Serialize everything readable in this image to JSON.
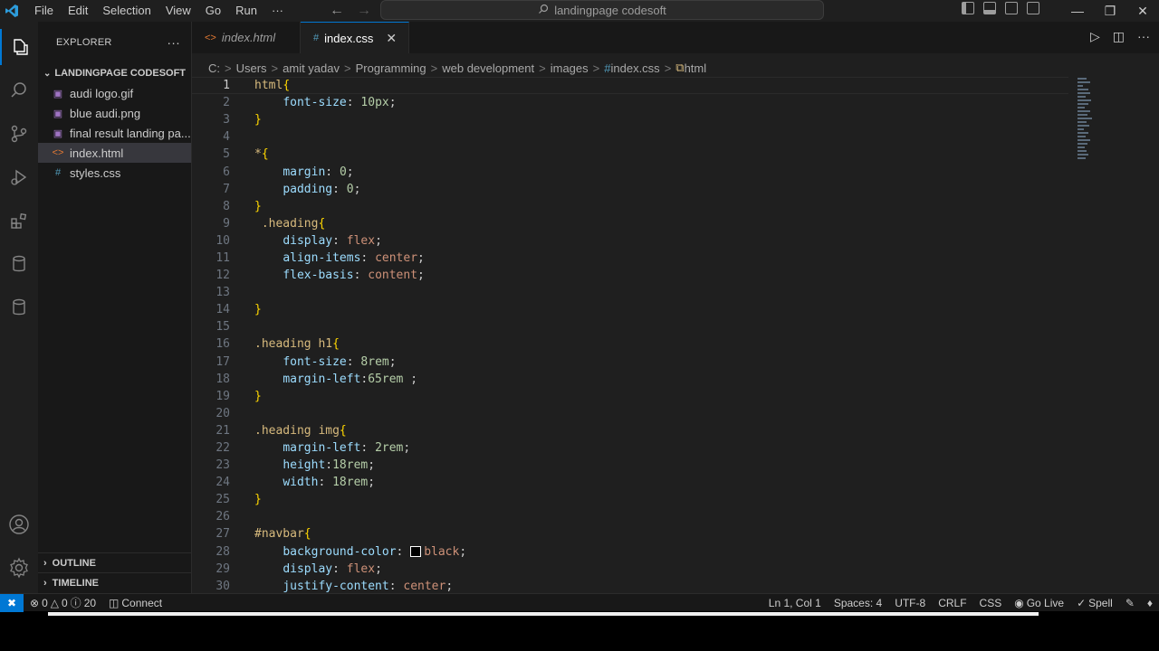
{
  "menu": [
    "File",
    "Edit",
    "Selection",
    "View",
    "Go",
    "Run",
    "···"
  ],
  "command_center": "landingpage codesoft",
  "explorer": {
    "title": "EXPLORER",
    "folder": "LANDINGPAGE CODESOFT",
    "files": [
      {
        "name": "audi logo.gif",
        "icon": "image-icon",
        "selected": false
      },
      {
        "name": "blue audi.png",
        "icon": "image-icon",
        "selected": false
      },
      {
        "name": "final result landing pa...",
        "icon": "image-icon",
        "selected": false
      },
      {
        "name": "index.html",
        "icon": "html-file-icon",
        "selected": true
      },
      {
        "name": "styles.css",
        "icon": "css-file-icon",
        "selected": false
      }
    ],
    "outline": "OUTLINE",
    "timeline": "TIMELINE"
  },
  "tabs": [
    {
      "label": "index.html",
      "icon": "html-file-icon",
      "active": false
    },
    {
      "label": "index.css",
      "icon": "css-file-icon",
      "active": true
    }
  ],
  "breadcrumb": [
    "C:",
    "Users",
    "amit yadav",
    "Programming",
    "web development",
    "images",
    "index.css",
    "html"
  ],
  "code_lines": [
    {
      "n": "1",
      "t": [
        [
          "sel",
          "html"
        ],
        [
          "br",
          "{"
        ]
      ]
    },
    {
      "n": "2",
      "t": [
        [
          "p",
          "    "
        ],
        [
          "prop",
          "font-size"
        ],
        [
          "p",
          ": "
        ],
        [
          "num",
          "10px"
        ],
        [
          "p",
          ";"
        ]
      ]
    },
    {
      "n": "3",
      "t": [
        [
          "br",
          "}"
        ]
      ]
    },
    {
      "n": "4",
      "t": []
    },
    {
      "n": "5",
      "t": [
        [
          "sel",
          "*"
        ],
        [
          "br",
          "{"
        ]
      ]
    },
    {
      "n": "6",
      "t": [
        [
          "p",
          "    "
        ],
        [
          "prop",
          "margin"
        ],
        [
          "p",
          ": "
        ],
        [
          "num",
          "0"
        ],
        [
          "p",
          ";"
        ]
      ]
    },
    {
      "n": "7",
      "t": [
        [
          "p",
          "    "
        ],
        [
          "prop",
          "padding"
        ],
        [
          "p",
          ": "
        ],
        [
          "num",
          "0"
        ],
        [
          "p",
          ";"
        ]
      ]
    },
    {
      "n": "8",
      "t": [
        [
          "br",
          "}"
        ]
      ]
    },
    {
      "n": "9",
      "t": [
        [
          "p",
          " "
        ],
        [
          "sel",
          ".heading"
        ],
        [
          "br",
          "{"
        ]
      ]
    },
    {
      "n": "10",
      "t": [
        [
          "p",
          "    "
        ],
        [
          "prop",
          "display"
        ],
        [
          "p",
          ": "
        ],
        [
          "val",
          "flex"
        ],
        [
          "p",
          ";"
        ]
      ]
    },
    {
      "n": "11",
      "t": [
        [
          "p",
          "    "
        ],
        [
          "prop",
          "align-items"
        ],
        [
          "p",
          ": "
        ],
        [
          "val",
          "center"
        ],
        [
          "p",
          ";"
        ]
      ]
    },
    {
      "n": "12",
      "t": [
        [
          "p",
          "    "
        ],
        [
          "prop",
          "flex-basis"
        ],
        [
          "p",
          ": "
        ],
        [
          "val",
          "content"
        ],
        [
          "p",
          ";"
        ]
      ]
    },
    {
      "n": "13",
      "t": []
    },
    {
      "n": "14",
      "t": [
        [
          "br",
          "}"
        ]
      ]
    },
    {
      "n": "15",
      "t": []
    },
    {
      "n": "16",
      "t": [
        [
          "sel",
          ".heading h1"
        ],
        [
          "br",
          "{"
        ]
      ]
    },
    {
      "n": "17",
      "t": [
        [
          "p",
          "    "
        ],
        [
          "prop",
          "font-size"
        ],
        [
          "p",
          ": "
        ],
        [
          "num",
          "8rem"
        ],
        [
          "p",
          ";"
        ]
      ]
    },
    {
      "n": "18",
      "t": [
        [
          "p",
          "    "
        ],
        [
          "prop",
          "margin-left"
        ],
        [
          "p",
          ":"
        ],
        [
          "num",
          "65rem"
        ],
        [
          "p",
          " ;"
        ]
      ]
    },
    {
      "n": "19",
      "t": [
        [
          "br",
          "}"
        ]
      ]
    },
    {
      "n": "20",
      "t": []
    },
    {
      "n": "21",
      "t": [
        [
          "sel",
          ".heading img"
        ],
        [
          "br",
          "{"
        ]
      ]
    },
    {
      "n": "22",
      "t": [
        [
          "p",
          "    "
        ],
        [
          "prop",
          "margin-left"
        ],
        [
          "p",
          ": "
        ],
        [
          "num",
          "2rem"
        ],
        [
          "p",
          ";"
        ]
      ]
    },
    {
      "n": "23",
      "t": [
        [
          "p",
          "    "
        ],
        [
          "prop",
          "height"
        ],
        [
          "p",
          ":"
        ],
        [
          "num",
          "18rem"
        ],
        [
          "p",
          ";"
        ]
      ]
    },
    {
      "n": "24",
      "t": [
        [
          "p",
          "    "
        ],
        [
          "prop",
          "width"
        ],
        [
          "p",
          ": "
        ],
        [
          "num",
          "18rem"
        ],
        [
          "p",
          ";"
        ]
      ]
    },
    {
      "n": "25",
      "t": [
        [
          "br",
          "}"
        ]
      ]
    },
    {
      "n": "26",
      "t": []
    },
    {
      "n": "27",
      "t": [
        [
          "sel",
          "#navbar"
        ],
        [
          "br",
          "{"
        ]
      ]
    },
    {
      "n": "28",
      "t": [
        [
          "p",
          "    "
        ],
        [
          "prop",
          "background-color"
        ],
        [
          "p",
          ": "
        ],
        [
          "swatch",
          ""
        ],
        [
          "val",
          "black"
        ],
        [
          "p",
          ";"
        ]
      ]
    },
    {
      "n": "29",
      "t": [
        [
          "p",
          "    "
        ],
        [
          "prop",
          "display"
        ],
        [
          "p",
          ": "
        ],
        [
          "val",
          "flex"
        ],
        [
          "p",
          ";"
        ]
      ]
    },
    {
      "n": "30",
      "t": [
        [
          "p",
          "    "
        ],
        [
          "prop",
          "justify-content"
        ],
        [
          "p",
          ": "
        ],
        [
          "val",
          "center"
        ],
        [
          "p",
          ";"
        ]
      ]
    }
  ],
  "status": {
    "errors": "0",
    "warnings": "0",
    "info": "20",
    "connect": "Connect",
    "position": "Ln 1, Col 1",
    "spaces": "Spaces: 4",
    "encoding": "UTF-8",
    "eol": "CRLF",
    "language": "CSS",
    "go_live": "Go Live",
    "spell": "Spell"
  },
  "colors": {
    "accent": "#0078d4",
    "selector": "#d7ba7d",
    "property": "#9cdcfe",
    "value": "#ce9178",
    "number": "#b5cea8",
    "bracket": "#ffd700"
  }
}
